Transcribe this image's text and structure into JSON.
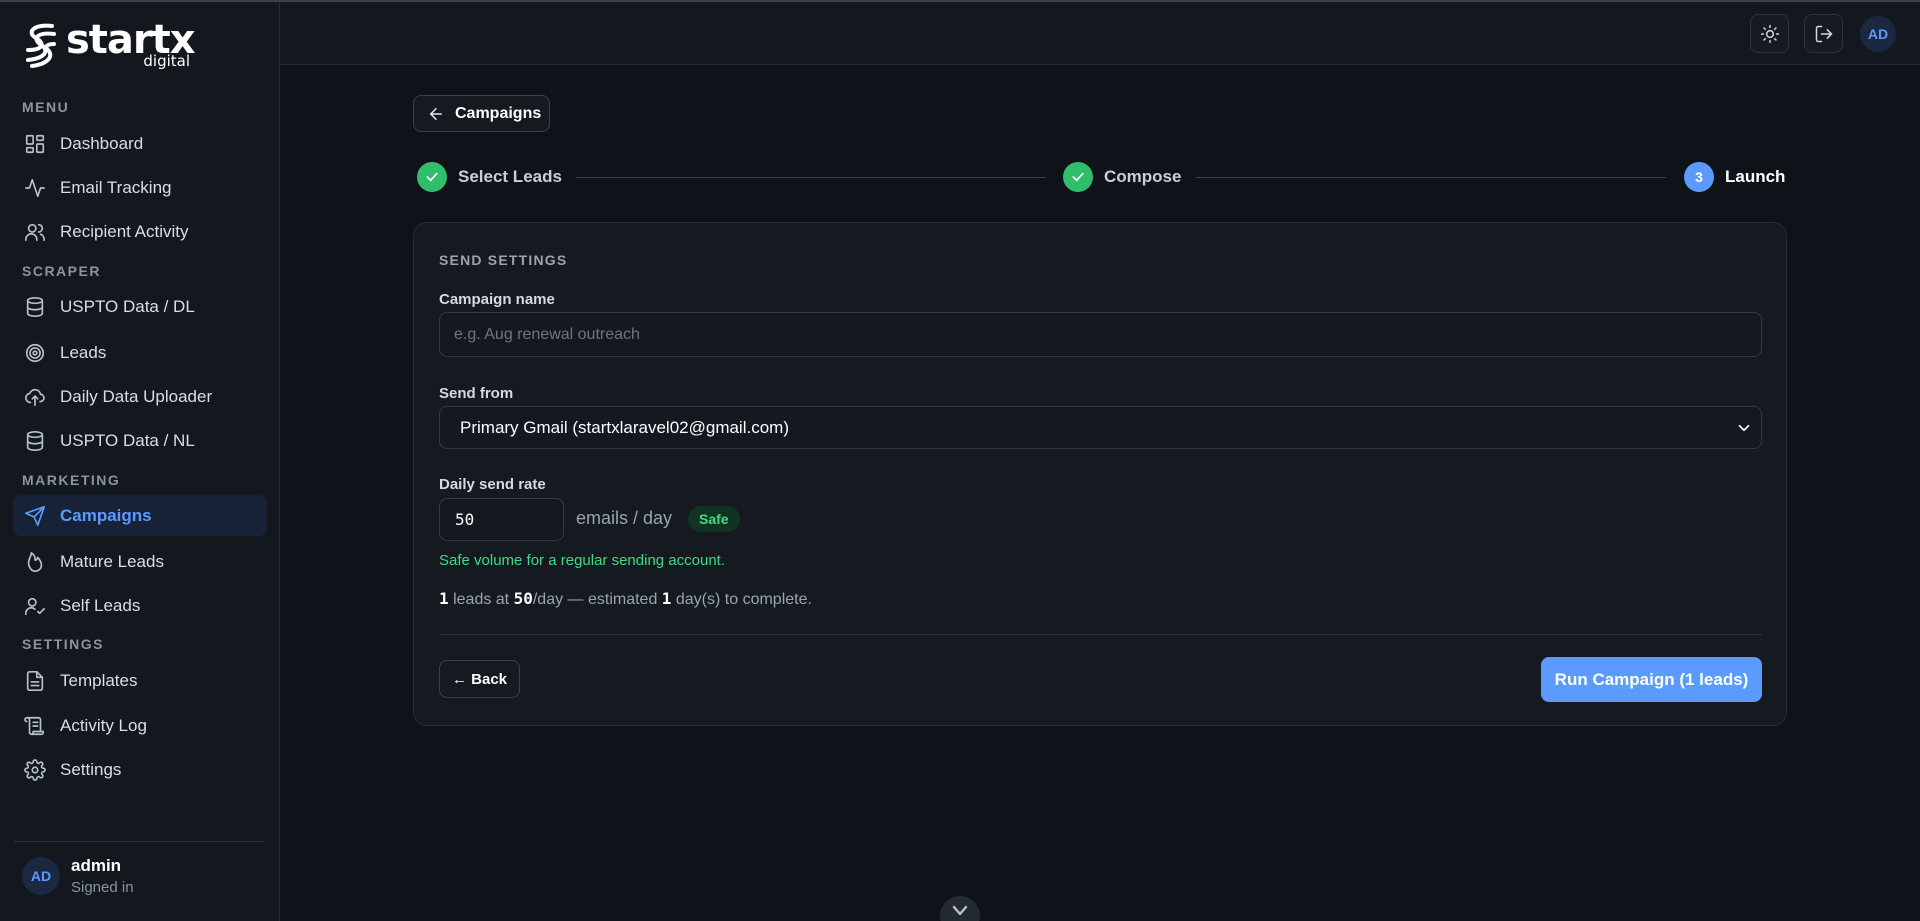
{
  "brand": {
    "name": "startx",
    "sub": "digital"
  },
  "sidebar": {
    "sections": {
      "menu": "MENU",
      "scraper": "SCRAPER",
      "marketing": "MARKETING",
      "settings": "SETTINGS"
    },
    "items": {
      "dashboard": "Dashboard",
      "email_tracking": "Email Tracking",
      "recipient_activity": "Recipient Activity",
      "uspto_dl": "USPTO Data / DL",
      "leads": "Leads",
      "daily_uploader": "Daily Data Uploader",
      "uspto_nl": "USPTO Data / NL",
      "campaigns": "Campaigns",
      "mature_leads": "Mature Leads",
      "self_leads": "Self Leads",
      "templates": "Templates",
      "activity_log": "Activity Log",
      "settings": "Settings"
    },
    "active": "campaigns",
    "user": {
      "initials": "AD",
      "name": "admin",
      "status": "Signed in"
    }
  },
  "header": {
    "avatar_initials": "AD",
    "icons": [
      "sun-icon",
      "logout-icon"
    ]
  },
  "main": {
    "back_label": "Campaigns",
    "steps": [
      {
        "label": "Select Leads",
        "state": "done"
      },
      {
        "label": "Compose",
        "state": "done"
      },
      {
        "label": "Launch",
        "state": "current",
        "number": "3"
      }
    ],
    "card": {
      "title": "SEND SETTINGS",
      "campaign_name": {
        "label": "Campaign name",
        "value": "",
        "placeholder": "e.g. Aug renewal outreach"
      },
      "send_from": {
        "label": "Send from",
        "value": "Primary Gmail (startxlaravel02@gmail.com)"
      },
      "daily_rate": {
        "label": "Daily send rate",
        "value": "50",
        "unit": "emails / day",
        "badge": "Safe"
      },
      "safe_note": "Safe volume for a regular sending account.",
      "estimate": {
        "leads": "1",
        "t1": " leads at ",
        "rate": "50",
        "t2": "/day — estimated ",
        "days": "1",
        "t3": " day(s) to complete."
      },
      "back_button": "← Back",
      "run_button": "Run Campaign (1 leads)"
    }
  },
  "colors": {
    "accent": "#5b9bff",
    "success": "#2fbf6b",
    "safe_text": "#3ddc84",
    "background": "#0f1218",
    "surface": "#151920"
  }
}
